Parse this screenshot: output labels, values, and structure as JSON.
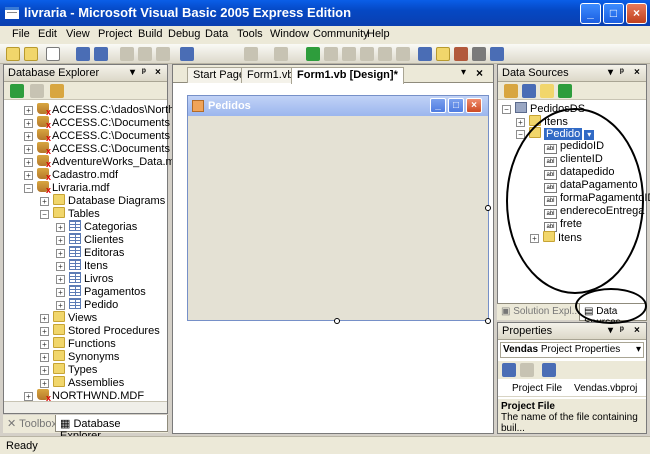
{
  "window": {
    "title": "livraria - Microsoft Visual Basic 2005 Express Edition"
  },
  "menu": [
    "File",
    "Edit",
    "View",
    "Project",
    "Build",
    "Debug",
    "Data",
    "Tools",
    "Window",
    "Community",
    "Help"
  ],
  "db_explorer": {
    "title": "Database Explorer",
    "nodes": [
      "ACCESS.C:\\dados\\North",
      "ACCESS.C:\\Documents a",
      "ACCESS.C:\\Documents a",
      "ACCESS.C:\\Documents a",
      "AdventureWorks_Data.m",
      "Cadastro.mdf",
      "Livraria.mdf",
      "Database Diagrams",
      "Tables",
      "Categorias",
      "Clientes",
      "Editoras",
      "Itens",
      "Livros",
      "Pagamentos",
      "Pedido",
      "Views",
      "Stored Procedures",
      "Functions",
      "Synonyms",
      "Types",
      "Assemblies",
      "NORTHWND.MDF"
    ]
  },
  "bottom_tabs": {
    "toolbox": "Toolbox",
    "db_explorer": "Database Explorer"
  },
  "doc_tabs": [
    "Start Page",
    "Form1.vb*",
    "Form1.vb [Design]*"
  ],
  "form": {
    "title": "Pedidos"
  },
  "data_sources": {
    "title": "Data Sources",
    "nodes": [
      "PedidosDS",
      "Itens",
      "Pedido",
      "pedidoID",
      "clienteID",
      "datapedido",
      "dataPagamento",
      "formaPagamentoID",
      "enderecoEntrega",
      "frete",
      "Itens"
    ],
    "field_icon_text": "abl"
  },
  "right_tabs": {
    "solution": "Solution Expl...",
    "data_sources": "Data Sources"
  },
  "properties": {
    "title": "Properties",
    "object": "Vendas",
    "object_type": "Project Properties",
    "row_name": "Project File",
    "row_value": "Vendas.vbproj",
    "desc_title": "Project File",
    "desc_text": "The name of the file containing buil..."
  },
  "status": {
    "text": "Ready"
  },
  "colors": {
    "title_bar": "#0548c4",
    "selection": "#316ac5",
    "chrome": "#ece9d8"
  }
}
